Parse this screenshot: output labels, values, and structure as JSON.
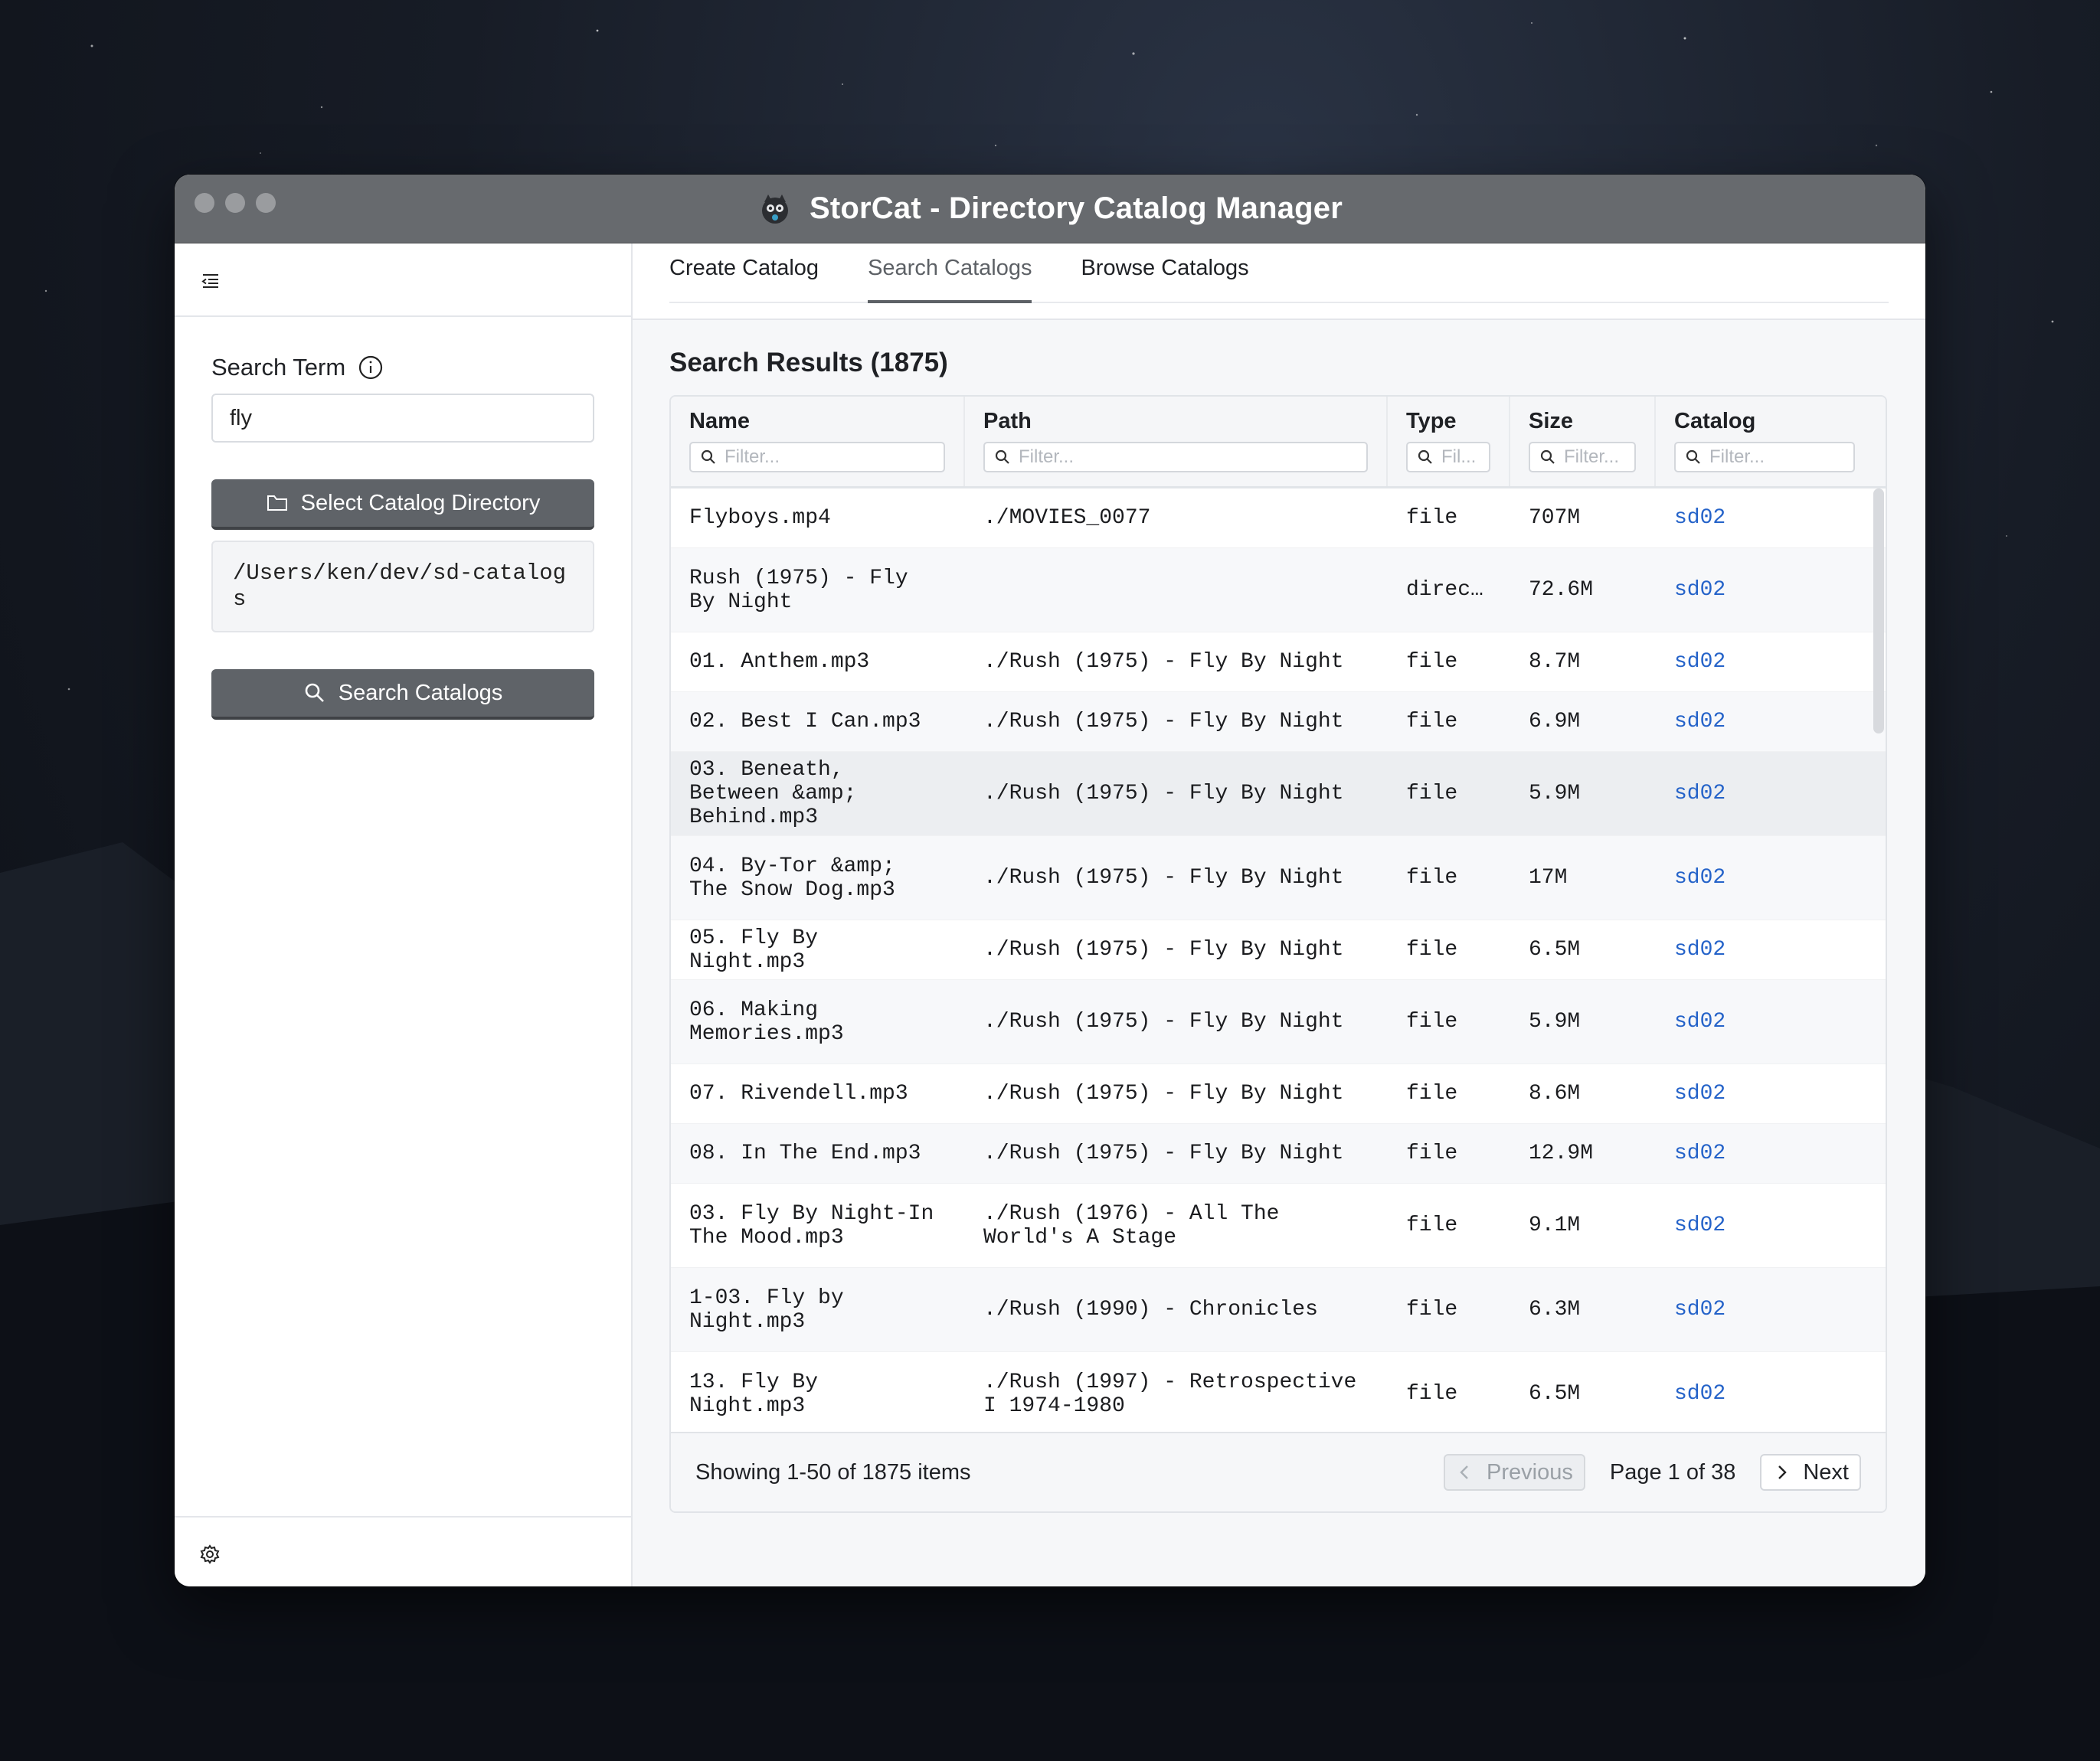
{
  "window": {
    "title": "StorCat - Directory Catalog Manager"
  },
  "sidebar": {
    "search_label": "Search Term",
    "search_value": "fly",
    "select_button": "Select Catalog Directory",
    "directory_path": "/Users/ken/dev/sd-catalogs",
    "search_button": "Search Catalogs"
  },
  "tabs": [
    "Create Catalog",
    "Search Catalogs",
    "Browse Catalogs"
  ],
  "active_tab": "Search Catalogs",
  "results": {
    "title": "Search Results (1875)",
    "columns": [
      "Name",
      "Path",
      "Type",
      "Size",
      "Catalog"
    ],
    "filter_placeholders": [
      "Filter...",
      "Filter...",
      "Fil...",
      "Filter...",
      "Filter..."
    ],
    "rows": [
      {
        "name": "Flyboys.mp4",
        "path": "./MOVIES_0077",
        "type": "file",
        "size": "707M",
        "catalog": "sd02"
      },
      {
        "name": "Rush (1975) - Fly By Night",
        "path": "",
        "type": "direc…",
        "size": "72.6M",
        "catalog": "sd02"
      },
      {
        "name": "01. Anthem.mp3",
        "path": "./Rush (1975) - Fly By Night",
        "type": "file",
        "size": "8.7M",
        "catalog": "sd02"
      },
      {
        "name": "02. Best I Can.mp3",
        "path": "./Rush (1975) - Fly By Night",
        "type": "file",
        "size": "6.9M",
        "catalog": "sd02"
      },
      {
        "name": "03. Beneath, Between &amp; Behind.mp3",
        "path": "./Rush (1975) - Fly By Night",
        "type": "file",
        "size": "5.9M",
        "catalog": "sd02"
      },
      {
        "name": "04. By-Tor &amp; The Snow Dog.mp3",
        "path": "./Rush (1975) - Fly By Night",
        "type": "file",
        "size": "17M",
        "catalog": "sd02"
      },
      {
        "name": "05. Fly By Night.mp3",
        "path": "./Rush (1975) - Fly By Night",
        "type": "file",
        "size": "6.5M",
        "catalog": "sd02"
      },
      {
        "name": "06. Making Memories.mp3",
        "path": "./Rush (1975) - Fly By Night",
        "type": "file",
        "size": "5.9M",
        "catalog": "sd02"
      },
      {
        "name": "07. Rivendell.mp3",
        "path": "./Rush (1975) - Fly By Night",
        "type": "file",
        "size": "8.6M",
        "catalog": "sd02"
      },
      {
        "name": "08. In The End.mp3",
        "path": "./Rush (1975) - Fly By Night",
        "type": "file",
        "size": "12.9M",
        "catalog": "sd02"
      },
      {
        "name": "03. Fly By Night-In The Mood.mp3",
        "path": "./Rush (1976) - All The World's A Stage",
        "type": "file",
        "size": "9.1M",
        "catalog": "sd02"
      },
      {
        "name": "1-03. Fly by Night.mp3",
        "path": "./Rush (1990) - Chronicles",
        "type": "file",
        "size": "6.3M",
        "catalog": "sd02"
      },
      {
        "name": "13. Fly By Night.mp3",
        "path": "./Rush (1997) - Retrospective I 1974-1980",
        "type": "file",
        "size": "6.5M",
        "catalog": "sd02"
      }
    ],
    "footer": {
      "showing": "Showing 1-50 of 1875 items",
      "previous": "Previous",
      "page": "Page 1 of 38",
      "next": "Next"
    }
  }
}
